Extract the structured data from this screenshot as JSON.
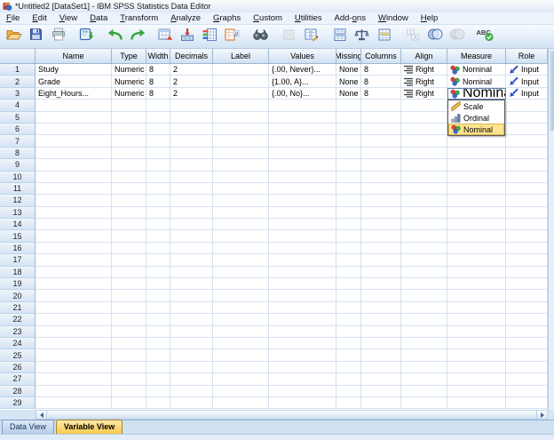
{
  "window": {
    "title": "*Untitled2 [DataSet1] - IBM SPSS Statistics Data Editor"
  },
  "menu": {
    "items": [
      {
        "label": "File",
        "accel": 0
      },
      {
        "label": "Edit",
        "accel": 0
      },
      {
        "label": "View",
        "accel": 0
      },
      {
        "label": "Data",
        "accel": 0
      },
      {
        "label": "Transform",
        "accel": 0
      },
      {
        "label": "Analyze",
        "accel": 0
      },
      {
        "label": "Graphs",
        "accel": 0
      },
      {
        "label": "Custom",
        "accel": 0
      },
      {
        "label": "Utilities",
        "accel": 0
      },
      {
        "label": "Add-ons",
        "accel": 4
      },
      {
        "label": "Window",
        "accel": 0
      },
      {
        "label": "Help",
        "accel": 0
      }
    ]
  },
  "toolbar": {
    "icons": [
      {
        "name": "open-data-icon"
      },
      {
        "name": "save-icon"
      },
      {
        "name": "print-icon"
      },
      {
        "name": "recall-dialogs-icon",
        "gap": true
      },
      {
        "name": "undo-icon",
        "gap": true
      },
      {
        "name": "redo-icon"
      },
      {
        "name": "goto-case-icon",
        "gap": true
      },
      {
        "name": "goto-variable-icon"
      },
      {
        "name": "variables-icon"
      },
      {
        "name": "descriptives-icon"
      },
      {
        "name": "find-icon",
        "gap": true
      },
      {
        "name": "insert-cases-icon",
        "disabled": true,
        "gap": true
      },
      {
        "name": "insert-variable-icon"
      },
      {
        "name": "split-file-icon",
        "gap": true
      },
      {
        "name": "weight-cases-icon"
      },
      {
        "name": "select-cases-icon"
      },
      {
        "name": "value-labels-icon",
        "disabled": true,
        "gap": true
      },
      {
        "name": "use-variable-sets-icon"
      },
      {
        "name": "show-all-variables-icon",
        "disabled": true
      },
      {
        "name": "spell-check-icon",
        "gap": true
      }
    ]
  },
  "grid": {
    "columns": [
      "",
      "Name",
      "Type",
      "Width",
      "Decimals",
      "Label",
      "Values",
      "Missing",
      "Columns",
      "Align",
      "Measure",
      "Role"
    ],
    "rows": [
      {
        "num": "1",
        "name": "Study",
        "type": "Numeric",
        "width": "8",
        "decimals": "2",
        "label": "",
        "values": "{.00, Never}...",
        "missing": "None",
        "columns": "8",
        "align": "Right",
        "measure": "Nominal",
        "role": "Input"
      },
      {
        "num": "2",
        "name": "Grade",
        "type": "Numeric",
        "width": "8",
        "decimals": "2",
        "label": "",
        "values": "{1.00, A}...",
        "missing": "None",
        "columns": "8",
        "align": "Right",
        "measure": "Nominal",
        "role": "Input"
      },
      {
        "num": "3",
        "name": "Eight_Hours...",
        "type": "Numeric",
        "width": "8",
        "decimals": "2",
        "label": "",
        "values": "{.00, No}...",
        "missing": "None",
        "columns": "8",
        "align": "Right",
        "measure": "Nominal",
        "role": "Input",
        "measure_combo_open": true
      }
    ],
    "total_row_count": 29
  },
  "measure_dropdown": {
    "open": true,
    "items": [
      {
        "label": "Scale",
        "icon": "scale-icon",
        "highlighted": false
      },
      {
        "label": "Ordinal",
        "icon": "ordinal-icon",
        "highlighted": false
      },
      {
        "label": "Nominal",
        "icon": "nominal-icon",
        "highlighted": true
      }
    ]
  },
  "tabs": [
    {
      "label": "Data View",
      "active": false
    },
    {
      "label": "Variable View",
      "active": true
    }
  ],
  "status_text": "",
  "colors": {
    "chrome": "#d6e5f5",
    "header_top": "#f5f9fd",
    "header_bottom": "#d0e0f2",
    "grid_line": "#d5e2f0",
    "header_line": "#9db9d6",
    "dropdown_highlight": "#ffe48f",
    "active_tab": "#f6c84e",
    "combo_button": "#eeb54e",
    "nominal_red": "#e04038",
    "nominal_green": "#3fa84c",
    "nominal_blue": "#3a66d4",
    "role_blue": "#2d53c4"
  }
}
